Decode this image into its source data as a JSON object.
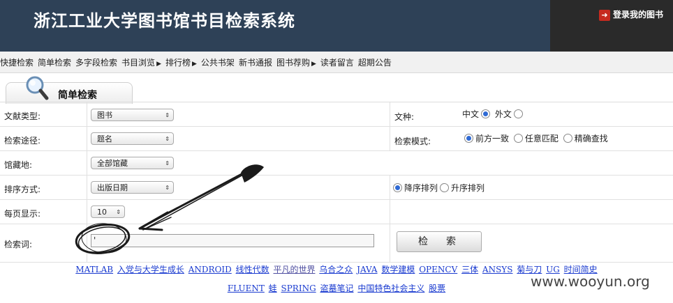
{
  "header": {
    "title": "浙江工业大学图书馆书目检索系统",
    "login": "登录我的图书"
  },
  "nav": [
    {
      "label": "快捷检索",
      "menu": false
    },
    {
      "label": "简单检索",
      "menu": false
    },
    {
      "label": "多字段检索",
      "menu": false
    },
    {
      "label": "书目浏览",
      "menu": true
    },
    {
      "label": "排行榜",
      "menu": true
    },
    {
      "label": "公共书架",
      "menu": false
    },
    {
      "label": "新书通报",
      "menu": false
    },
    {
      "label": "图书荐购",
      "menu": true
    },
    {
      "label": "读者留言",
      "menu": false
    },
    {
      "label": "超期公告",
      "menu": false
    }
  ],
  "tab": {
    "label": "简单检索",
    "icon": "magnifier-icon"
  },
  "form": {
    "doc_type": {
      "label": "文献类型:",
      "value": "图书"
    },
    "language": {
      "label": "文种:",
      "chinese": "中文",
      "foreign": "外文",
      "selected": "chinese"
    },
    "route": {
      "label": "检索途径:",
      "value": "题名"
    },
    "mode": {
      "label": "检索模式:",
      "opt1": "前方一致",
      "opt2": "任意匹配",
      "opt3": "精确查找",
      "selected": "opt1"
    },
    "library": {
      "label": "馆藏地:",
      "value": "全部馆藏"
    },
    "sort": {
      "label": "排序方式:",
      "value": "出版日期",
      "desc": "降序排列",
      "asc": "升序排列",
      "selected": "desc"
    },
    "per_page": {
      "label": "每页显示:",
      "value": "10"
    },
    "keyword": {
      "label": "检索词:",
      "value": "'"
    },
    "button": "检　索"
  },
  "hot_words_line1": [
    "MATLAB",
    "入党与大学生成长",
    "ANDROID",
    "线性代数",
    "平凡的世界",
    "乌合之众",
    "JAVA",
    "数学建模",
    "OPENCV",
    "三体",
    "ANSYS",
    "菊与刀",
    "UG",
    "时间简史"
  ],
  "hot_words_line2": [
    "FLUENT",
    "蛙",
    "SPRING",
    "盗墓笔记",
    "中国特色社会主义",
    "股票"
  ],
  "watermark": "www.wooyun.org"
}
